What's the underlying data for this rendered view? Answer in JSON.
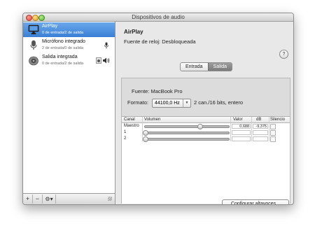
{
  "window": {
    "title": "Dispositivos de audio"
  },
  "sidebar": {
    "devices": [
      {
        "name": "AirPlay",
        "subtitle": "0 de entrada/2 de salida",
        "icon": "airplay-icon",
        "selected": true
      },
      {
        "name": "Micrófono integrado",
        "subtitle": "2 de entrada/0 de salida",
        "icon": "microphone-icon",
        "selected": false
      },
      {
        "name": "Salida integrada",
        "subtitle": "0 de entrada/2 de salida",
        "icon": "speaker-icon",
        "selected": false
      }
    ],
    "add_label": "+",
    "remove_label": "−",
    "gear_label": "⚙▾"
  },
  "main": {
    "title": "AirPlay",
    "clock_source": "Fuente de reloj: Desbloqueada",
    "help_label": "?",
    "tabs": [
      {
        "label": "Entrada",
        "active": false
      },
      {
        "label": "Salida",
        "active": true
      }
    ],
    "source": "Fuente:  MacBook Pro",
    "format_label": "Formato:",
    "format_value": "44100,0 Hz",
    "format_desc": "2 can./16 bits, entero",
    "table": {
      "headers": [
        "Canal",
        "Volumen",
        "Valor",
        "dB",
        "Silencio"
      ],
      "rows": [
        {
          "channel": "Maestro",
          "level": 0.688,
          "value": "0,688",
          "db": "-9,375",
          "mute": false
        },
        {
          "channel": "1",
          "level": 0,
          "value": "",
          "db": "",
          "mute": false
        },
        {
          "channel": "2",
          "level": 0,
          "value": "",
          "db": "",
          "mute": false
        }
      ]
    },
    "configure_label": "Configurar altavoces..."
  }
}
